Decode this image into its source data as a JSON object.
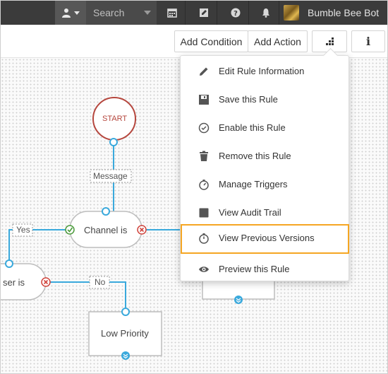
{
  "topbar": {
    "search_placeholder": "Search",
    "bot_name": "Bumble Bee Bot",
    "icons": [
      "user-icon",
      "calendar-icon",
      "edit-icon",
      "help-icon",
      "bell-icon"
    ]
  },
  "toolbar": {
    "add_condition": "Add Condition",
    "add_action": "Add Action",
    "info": "i"
  },
  "menu": {
    "items": [
      {
        "label": "Edit Rule Information",
        "icon": "pencil-icon"
      },
      {
        "label": "Save this Rule",
        "icon": "floppy-icon"
      },
      {
        "label": "Enable this Rule",
        "icon": "check-circle-icon"
      },
      {
        "label": "Remove this Rule",
        "icon": "trash-icon"
      },
      {
        "label": "Manage Triggers",
        "icon": "stopwatch-icon"
      },
      {
        "label": "View Audit Trail",
        "icon": "book-icon"
      },
      {
        "label": "View Previous Versions",
        "icon": "timer-icon",
        "highlighted": true
      },
      {
        "label": "Preview this Rule",
        "icon": "eye-icon"
      }
    ]
  },
  "flow": {
    "start": "START",
    "message": "Message",
    "channel_is": "Channel is",
    "yes": "Yes",
    "user_is": "ser is",
    "no": "No",
    "low_priority": "Low Priority"
  },
  "colors": {
    "accent_blue": "#3aa9dc",
    "start_red": "#b5463d",
    "check_green": "#4a9a3a",
    "cross_red": "#d0443c",
    "highlight_orange": "#f5a623",
    "topbar_bg": "#3b3b3b"
  }
}
